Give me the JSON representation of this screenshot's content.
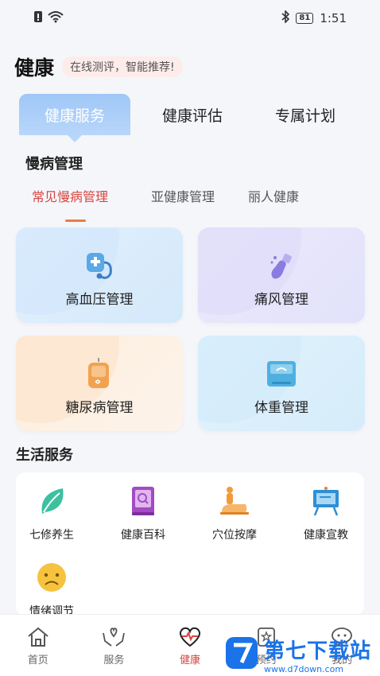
{
  "status_bar": {
    "time": "1:51",
    "battery": "81"
  },
  "header": {
    "title": "健康",
    "tagline": "在线测评，智能推荐!"
  },
  "tabs": [
    {
      "label": "健康服务",
      "active": true
    },
    {
      "label": "健康评估",
      "active": false
    },
    {
      "label": "专属计划",
      "active": false
    }
  ],
  "chronic": {
    "title": "慢病管理",
    "subtabs": [
      {
        "label": "常见慢病管理",
        "active": true
      },
      {
        "label": "亚健康管理",
        "active": false
      },
      {
        "label": "丽人健康",
        "active": false
      }
    ],
    "cards": [
      {
        "label": "高血压管理",
        "icon": "stethoscope-icon"
      },
      {
        "label": "痛风管理",
        "icon": "foot-icon"
      },
      {
        "label": "糖尿病管理",
        "icon": "glucose-meter-icon"
      },
      {
        "label": "体重管理",
        "icon": "weight-scale-icon"
      }
    ]
  },
  "life": {
    "title": "生活服务",
    "items": [
      {
        "label": "七修养生",
        "icon": "leaf-icon"
      },
      {
        "label": "健康百科",
        "icon": "book-icon"
      },
      {
        "label": "穴位按摩",
        "icon": "massage-icon"
      },
      {
        "label": "健康宣教",
        "icon": "easel-icon"
      },
      {
        "label": "情绪调节",
        "icon": "sad-face-icon"
      }
    ]
  },
  "bottom_nav": [
    {
      "label": "首页",
      "icon": "home-icon",
      "active": false
    },
    {
      "label": "服务",
      "icon": "hands-heart-icon",
      "active": false
    },
    {
      "label": "健康",
      "icon": "heart-pulse-icon",
      "active": true
    },
    {
      "label": "预约",
      "icon": "star-doc-icon",
      "active": false
    },
    {
      "label": "我的",
      "icon": "chat-icon",
      "active": false
    }
  ],
  "watermark": {
    "brand": "第七下载站",
    "url": "www.d7down.com"
  },
  "colors": {
    "accent": "#d6463f",
    "tab_active": "#a9cdf7",
    "brand_blue": "#1a73e8"
  }
}
